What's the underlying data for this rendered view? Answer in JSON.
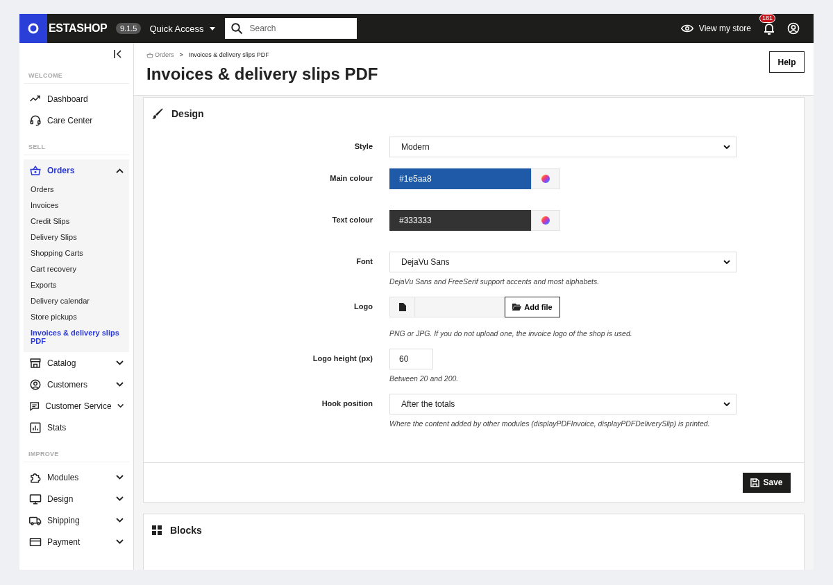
{
  "topbar": {
    "logo_text": "ESTASHOP",
    "version": "9.1.5",
    "quick_access": "Quick Access",
    "search": {
      "placeholder": "Search"
    },
    "view_store": "View my store",
    "notifications": "181"
  },
  "sidebar": {
    "sections": [
      {
        "heading": "WELCOME",
        "items": [
          {
            "label": "Dashboard",
            "selected": false
          },
          {
            "label": "Care Center",
            "selected": false
          }
        ]
      },
      {
        "heading": "SELL",
        "items": [
          {
            "label": "Orders",
            "selected": true,
            "expanded": true,
            "children": [
              {
                "label": "Orders",
                "selected": false
              },
              {
                "label": "Invoices",
                "selected": false
              },
              {
                "label": "Credit Slips",
                "selected": false
              },
              {
                "label": "Delivery Slips",
                "selected": false
              },
              {
                "label": "Shopping Carts",
                "selected": false
              },
              {
                "label": "Cart recovery",
                "selected": false
              },
              {
                "label": "Exports",
                "selected": false
              },
              {
                "label": "Delivery calendar",
                "selected": false
              },
              {
                "label": "Store pickups",
                "selected": false
              },
              {
                "label": "Invoices & delivery slips PDF",
                "selected": true
              }
            ]
          },
          {
            "label": "Catalog",
            "selected": false,
            "expanded": false
          },
          {
            "label": "Customers",
            "selected": false,
            "expanded": false
          },
          {
            "label": "Customer Service",
            "selected": false,
            "expanded": false
          },
          {
            "label": "Stats",
            "selected": false
          }
        ]
      },
      {
        "heading": "IMPROVE",
        "items": [
          {
            "label": "Modules",
            "selected": false,
            "expanded": false
          },
          {
            "label": "Design",
            "selected": false,
            "expanded": false
          },
          {
            "label": "Shipping",
            "selected": false,
            "expanded": false
          },
          {
            "label": "Payment",
            "selected": false,
            "expanded": false
          }
        ]
      }
    ]
  },
  "breadcrumb": [
    "Orders",
    "Invoices & delivery slips PDF"
  ],
  "breadcrumb_separator": ">",
  "page_title": "Invoices & delivery slips PDF",
  "help_button": "Help",
  "design_card": {
    "title": "Design",
    "fields": [
      {
        "kind": "select",
        "label": "Style",
        "value": "Modern"
      },
      {
        "kind": "color",
        "label": "Main colour",
        "value": "#1e5aa8"
      },
      {
        "kind": "color",
        "label": "Text colour",
        "value": "#333333"
      },
      {
        "kind": "select",
        "label": "Font",
        "value": "DejaVu Sans",
        "help": "DejaVu Sans and FreeSerif support accents and most alphabets."
      },
      {
        "kind": "file",
        "label": "Logo",
        "button": "Add file",
        "help": "PNG or JPG. If you do not upload one, the invoice logo of the shop is used."
      },
      {
        "kind": "number",
        "label": "Logo height (px)",
        "value": "60",
        "help": "Between 20 and 200."
      },
      {
        "kind": "select",
        "label": "Hook position",
        "value": "After the totals",
        "help": "Where the content added by other modules (displayPDFInvoice, displayPDFDeliverySlip) is printed."
      }
    ],
    "save_button": "Save"
  },
  "blocks_card": {
    "title": "Blocks"
  }
}
